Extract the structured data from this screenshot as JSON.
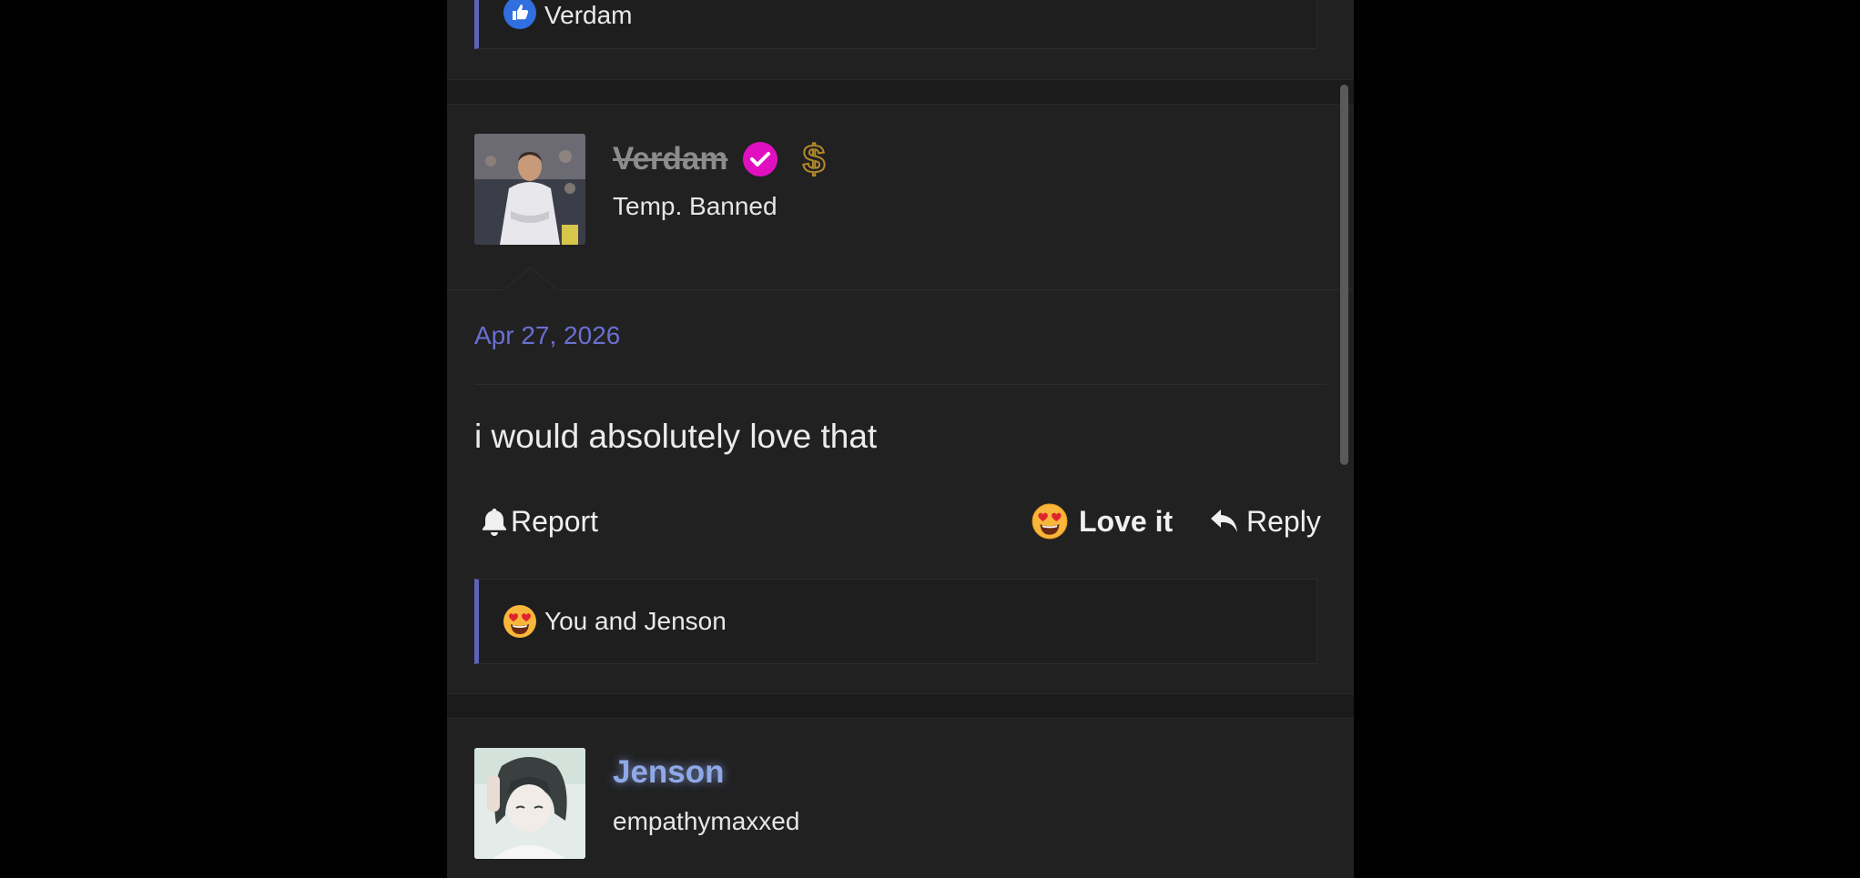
{
  "previous_post": {
    "reaction_summary": "Verdam",
    "reaction_icon": "like-icon"
  },
  "post": {
    "username": "Verdam",
    "username_style": "strikethrough",
    "verified_icon": "verified-check-icon",
    "verified_color": "#e010c0",
    "premium_icon": "dollar-icon",
    "premium_color": "#b58a2a",
    "user_title": "Temp. Banned",
    "date": "Apr 27, 2026",
    "date_color": "#6a6fd0",
    "body": "i would absolutely love that",
    "actions": {
      "report_label": "Report",
      "love_label": "Love it",
      "reply_label": "Reply"
    },
    "reaction_summary": "You and Jenson",
    "reaction_icon": "heart-eyes-emoji"
  },
  "next_post": {
    "username": "Jenson",
    "username_color": "#8fa8e8",
    "user_title": "empathymaxxed"
  },
  "colors": {
    "background": "#000000",
    "panel": "#212122",
    "accent": "#5f63b8"
  }
}
